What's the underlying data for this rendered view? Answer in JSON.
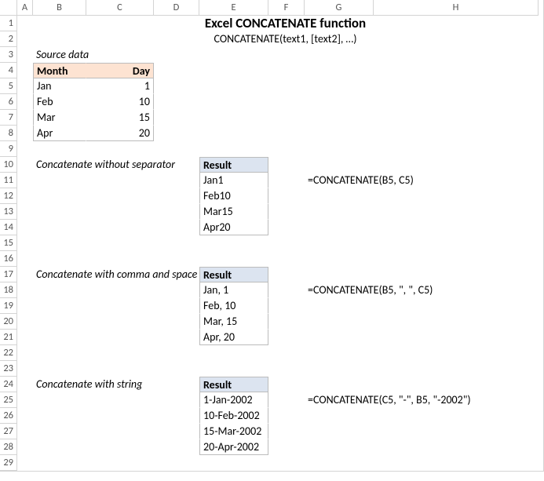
{
  "columns": [
    "A",
    "B",
    "C",
    "D",
    "E",
    "F",
    "G",
    "H"
  ],
  "rowCount": 29,
  "title": "Excel CONCATENATE function",
  "subtitle": "CONCATENATE(text1, [text2], …)",
  "sourceLabel": "Source data",
  "monthHeader": "Month",
  "dayHeader": "Day",
  "months": [
    "Jan",
    "Feb",
    "Mar",
    "Apr"
  ],
  "days": [
    "1",
    "10",
    "15",
    "20"
  ],
  "sections": [
    {
      "label": "Concatenate without separator",
      "resultHeader": "Result",
      "results": [
        "Jan1",
        "Feb10",
        "Mar15",
        "Apr20"
      ],
      "formula": "=CONCATENATE(B5, C5)"
    },
    {
      "label": "Concatenate with comma and space",
      "resultHeader": "Result",
      "results": [
        "Jan, 1",
        "Feb, 10",
        "Mar, 15",
        "Apr, 20"
      ],
      "formula": "=CONCATENATE(B5, \", \",  C5)"
    },
    {
      "label": "Concatenate with string",
      "resultHeader": "Result",
      "results": [
        "1-Jan-2002",
        "10-Feb-2002",
        "15-Mar-2002",
        "20-Apr-2002"
      ],
      "formula": "=CONCATENATE(C5, \"-\", B5, \"-2002\")"
    }
  ]
}
